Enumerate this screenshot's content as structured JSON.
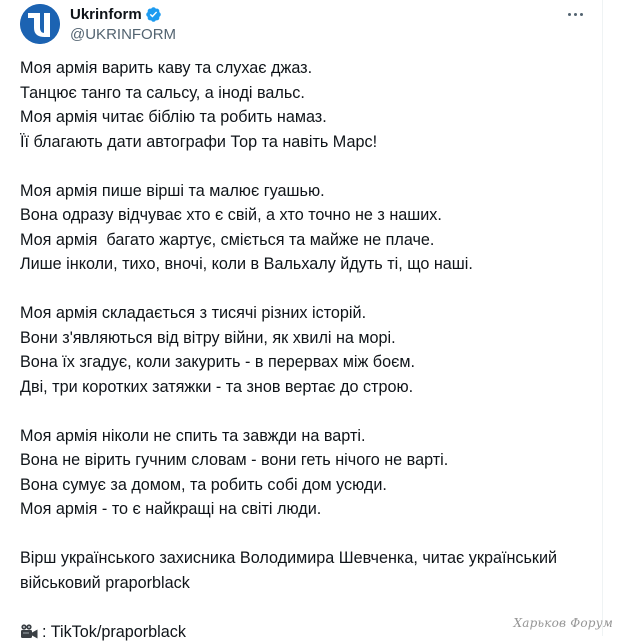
{
  "author": {
    "display_name": "Ukrinform",
    "handle": "@UKRINFORM",
    "verified": true,
    "avatar_icon": "ukrinform-logo-icon",
    "avatar_color": "#1c63b2"
  },
  "tweet": {
    "stanzas": [
      [
        "Моя армія варить каву та слухає джаз.",
        "Танцює танго та сальсу, а іноді вальс.",
        "Моя армія читає біблію та робить намаз.",
        "Її благають дати автографи Тор та навіть Марс!"
      ],
      [
        "Моя армія пише вірші та малює гуашью.",
        "Вона одразу відчуває хто є свій, а хто точно не з наших.",
        "Моя армія  багато жартує, сміється та майже не плаче.",
        "Лише інколи, тихо, вночі, коли в Вальхалу йдуть ті, що наші."
      ],
      [
        "Моя армія складається з тисячі різних історій.",
        "Вони з'являються від вітру війни, як хвилі на морі.",
        "Вона їх згадує, коли закурить - в перервах між боєм.",
        "Дві, три коротких затяжки - та знов вертає до строю."
      ],
      [
        "Моя армія ніколи не спить та завжди на варті.",
        "Вона не вірить гучним словам - вони геть нічого не варті.",
        "Вона сумує за домом, та робить собі дом усюди.",
        "Моя армія - то є найкращі на світі люди."
      ]
    ],
    "credit_lines": [
      "Вірш українського захисника Володимира Шевченка, читає український",
      "військовий praporblack"
    ],
    "source_icon": "video-camera-icon",
    "source_text": ": TikTok/praporblack"
  },
  "watermark": "Харьков Форум",
  "colors": {
    "text": "#0f1419",
    "secondary": "#536471",
    "verified": "#1d9bf0"
  }
}
